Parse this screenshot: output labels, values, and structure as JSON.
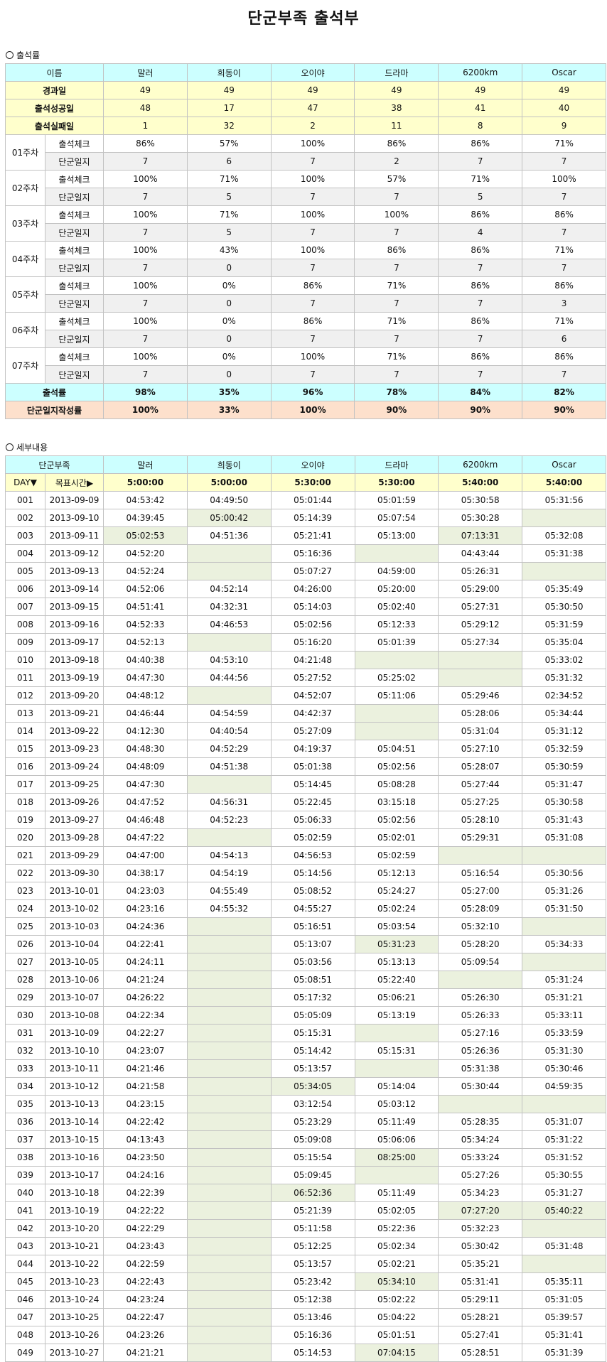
{
  "title": "단군부족 출석부",
  "section1": "출석률",
  "section2": "세부내용",
  "names": [
    "말러",
    "희동이",
    "오이야",
    "드라마",
    "6200km",
    "Oscar"
  ],
  "summary": {
    "name_header": "이름",
    "rows": [
      {
        "label": "경과일",
        "values": [
          "49",
          "49",
          "49",
          "49",
          "49",
          "49"
        ]
      },
      {
        "label": "출석성공일",
        "values": [
          "48",
          "17",
          "47",
          "38",
          "41",
          "40"
        ]
      },
      {
        "label": "출석실패일",
        "values": [
          "1",
          "32",
          "2",
          "11",
          "8",
          "9"
        ]
      }
    ],
    "check_label": "출석체크",
    "log_label": "단군일지",
    "weeks": [
      {
        "label": "01주차",
        "check": [
          "86%",
          "57%",
          "100%",
          "86%",
          "86%",
          "71%"
        ],
        "log": [
          "7",
          "6",
          "7",
          "2",
          "7",
          "7"
        ]
      },
      {
        "label": "02주차",
        "check": [
          "100%",
          "71%",
          "100%",
          "57%",
          "71%",
          "100%"
        ],
        "log": [
          "7",
          "5",
          "7",
          "7",
          "5",
          "7"
        ]
      },
      {
        "label": "03주차",
        "check": [
          "100%",
          "71%",
          "100%",
          "100%",
          "86%",
          "86%"
        ],
        "log": [
          "7",
          "5",
          "7",
          "7",
          "4",
          "7"
        ]
      },
      {
        "label": "04주차",
        "check": [
          "100%",
          "43%",
          "100%",
          "86%",
          "86%",
          "71%"
        ],
        "log": [
          "7",
          "0",
          "7",
          "7",
          "7",
          "7"
        ]
      },
      {
        "label": "05주차",
        "check": [
          "100%",
          "0%",
          "86%",
          "71%",
          "86%",
          "86%"
        ],
        "log": [
          "7",
          "0",
          "7",
          "7",
          "7",
          "3"
        ]
      },
      {
        "label": "06주차",
        "check": [
          "100%",
          "0%",
          "86%",
          "71%",
          "86%",
          "71%"
        ],
        "log": [
          "7",
          "0",
          "7",
          "7",
          "7",
          "6"
        ]
      },
      {
        "label": "07주차",
        "check": [
          "100%",
          "0%",
          "100%",
          "71%",
          "86%",
          "86%"
        ],
        "log": [
          "7",
          "0",
          "7",
          "7",
          "7",
          "7"
        ]
      }
    ],
    "rate": {
      "label": "출석률",
      "values": [
        "98%",
        "35%",
        "96%",
        "78%",
        "84%",
        "82%"
      ]
    },
    "log_rate": {
      "label": "단군일지작성률",
      "values": [
        "100%",
        "33%",
        "100%",
        "90%",
        "90%",
        "90%"
      ]
    }
  },
  "detail": {
    "tribe_header": "단군부족",
    "day_header": "DAY▼",
    "target_header": "목표시간▶",
    "targets": [
      "5:00:00",
      "5:00:00",
      "5:30:00",
      "5:30:00",
      "5:40:00",
      "5:40:00"
    ],
    "rows": [
      [
        "001",
        "2013-09-09",
        "04:53:42",
        "04:49:50",
        "05:01:44",
        "05:01:59",
        "05:30:58",
        "05:31:56"
      ],
      [
        "002",
        "2013-09-10",
        "04:39:45",
        "05:00:42",
        "05:14:39",
        "05:07:54",
        "05:30:28",
        ""
      ],
      [
        "003",
        "2013-09-11",
        "05:02:53",
        "04:51:36",
        "05:21:41",
        "05:13:00",
        "07:13:31",
        "05:32:08"
      ],
      [
        "004",
        "2013-09-12",
        "04:52:20",
        "",
        "05:16:36",
        "",
        "04:43:44",
        "05:31:38"
      ],
      [
        "005",
        "2013-09-13",
        "04:52:24",
        "",
        "05:07:27",
        "04:59:00",
        "05:26:31",
        ""
      ],
      [
        "006",
        "2013-09-14",
        "04:52:06",
        "04:52:14",
        "04:26:00",
        "05:20:00",
        "05:29:00",
        "05:35:49"
      ],
      [
        "007",
        "2013-09-15",
        "04:51:41",
        "04:32:31",
        "05:14:03",
        "05:02:40",
        "05:27:31",
        "05:30:50"
      ],
      [
        "008",
        "2013-09-16",
        "04:52:33",
        "04:46:53",
        "05:02:56",
        "05:12:33",
        "05:29:12",
        "05:31:59"
      ],
      [
        "009",
        "2013-09-17",
        "04:52:13",
        "",
        "05:16:20",
        "05:01:39",
        "05:27:34",
        "05:35:04"
      ],
      [
        "010",
        "2013-09-18",
        "04:40:38",
        "04:53:10",
        "04:21:48",
        "",
        "",
        "05:33:02"
      ],
      [
        "011",
        "2013-09-19",
        "04:47:30",
        "04:44:56",
        "05:27:52",
        "05:25:02",
        "",
        "05:31:32"
      ],
      [
        "012",
        "2013-09-20",
        "04:48:12",
        "",
        "04:52:07",
        "05:11:06",
        "05:29:46",
        "02:34:52"
      ],
      [
        "013",
        "2013-09-21",
        "04:46:44",
        "04:54:59",
        "04:42:37",
        "",
        "05:28:06",
        "05:34:44"
      ],
      [
        "014",
        "2013-09-22",
        "04:12:30",
        "04:40:54",
        "05:27:09",
        "",
        "05:31:04",
        "05:31:12"
      ],
      [
        "015",
        "2013-09-23",
        "04:48:30",
        "04:52:29",
        "04:19:37",
        "05:04:51",
        "05:27:10",
        "05:32:59"
      ],
      [
        "016",
        "2013-09-24",
        "04:48:09",
        "04:51:38",
        "05:01:38",
        "05:02:56",
        "05:28:07",
        "05:30:59"
      ],
      [
        "017",
        "2013-09-25",
        "04:47:30",
        "",
        "05:14:45",
        "05:08:28",
        "05:27:44",
        "05:31:47"
      ],
      [
        "018",
        "2013-09-26",
        "04:47:52",
        "04:56:31",
        "05:22:45",
        "03:15:18",
        "05:27:25",
        "05:30:58"
      ],
      [
        "019",
        "2013-09-27",
        "04:46:48",
        "04:52:23",
        "05:06:33",
        "05:02:56",
        "05:28:10",
        "05:31:43"
      ],
      [
        "020",
        "2013-09-28",
        "04:47:22",
        "",
        "05:02:59",
        "05:02:01",
        "05:29:31",
        "05:31:08"
      ],
      [
        "021",
        "2013-09-29",
        "04:47:00",
        "04:54:13",
        "04:56:53",
        "05:02:59",
        "",
        ""
      ],
      [
        "022",
        "2013-09-30",
        "04:38:17",
        "04:54:19",
        "05:14:56",
        "05:12:13",
        "05:16:54",
        "05:30:56"
      ],
      [
        "023",
        "2013-10-01",
        "04:23:03",
        "04:55:49",
        "05:08:52",
        "05:24:27",
        "05:27:00",
        "05:31:26"
      ],
      [
        "024",
        "2013-10-02",
        "04:23:16",
        "04:55:32",
        "04:55:27",
        "05:02:24",
        "05:28:09",
        "05:31:50"
      ],
      [
        "025",
        "2013-10-03",
        "04:24:36",
        "",
        "05:16:51",
        "05:03:54",
        "05:32:10",
        ""
      ],
      [
        "026",
        "2013-10-04",
        "04:22:41",
        "",
        "05:13:07",
        "05:31:23",
        "05:28:20",
        "05:34:33"
      ],
      [
        "027",
        "2013-10-05",
        "04:24:11",
        "",
        "05:03:56",
        "05:13:13",
        "05:09:54",
        ""
      ],
      [
        "028",
        "2013-10-06",
        "04:21:24",
        "",
        "05:08:51",
        "05:22:40",
        "",
        "05:31:24"
      ],
      [
        "029",
        "2013-10-07",
        "04:26:22",
        "",
        "05:17:32",
        "05:06:21",
        "05:26:30",
        "05:31:21"
      ],
      [
        "030",
        "2013-10-08",
        "04:22:34",
        "",
        "05:05:09",
        "05:13:19",
        "05:26:33",
        "05:33:11"
      ],
      [
        "031",
        "2013-10-09",
        "04:22:27",
        "",
        "05:15:31",
        "",
        "05:27:16",
        "05:33:59"
      ],
      [
        "032",
        "2013-10-10",
        "04:23:07",
        "",
        "05:14:42",
        "05:15:31",
        "05:26:36",
        "05:31:30"
      ],
      [
        "033",
        "2013-10-11",
        "04:21:46",
        "",
        "05:13:57",
        "",
        "05:31:38",
        "05:30:46"
      ],
      [
        "034",
        "2013-10-12",
        "04:21:58",
        "",
        "05:34:05",
        "05:14:04",
        "05:30:44",
        "04:59:35"
      ],
      [
        "035",
        "2013-10-13",
        "04:23:15",
        "",
        "03:12:54",
        "05:03:12",
        "",
        ""
      ],
      [
        "036",
        "2013-10-14",
        "04:22:42",
        "",
        "05:23:29",
        "05:11:49",
        "05:28:35",
        "05:31:07"
      ],
      [
        "037",
        "2013-10-15",
        "04:13:43",
        "",
        "05:09:08",
        "05:06:06",
        "05:34:24",
        "05:31:22"
      ],
      [
        "038",
        "2013-10-16",
        "04:23:50",
        "",
        "05:15:54",
        "08:25:00",
        "05:33:24",
        "05:31:52"
      ],
      [
        "039",
        "2013-10-17",
        "04:24:16",
        "",
        "05:09:45",
        "",
        "05:27:26",
        "05:30:55"
      ],
      [
        "040",
        "2013-10-18",
        "04:22:39",
        "",
        "06:52:36",
        "05:11:49",
        "05:34:23",
        "05:31:27"
      ],
      [
        "041",
        "2013-10-19",
        "04:22:22",
        "",
        "05:21:39",
        "05:02:05",
        "07:27:20",
        "05:40:22"
      ],
      [
        "042",
        "2013-10-20",
        "04:22:29",
        "",
        "05:11:58",
        "05:22:36",
        "05:32:23",
        ""
      ],
      [
        "043",
        "2013-10-21",
        "04:23:43",
        "",
        "05:12:25",
        "05:02:34",
        "05:30:42",
        "05:31:48"
      ],
      [
        "044",
        "2013-10-22",
        "04:22:59",
        "",
        "05:13:57",
        "05:02:21",
        "05:35:21",
        ""
      ],
      [
        "045",
        "2013-10-23",
        "04:22:43",
        "",
        "05:23:42",
        "05:34:10",
        "05:31:41",
        "05:35:11"
      ],
      [
        "046",
        "2013-10-24",
        "04:23:24",
        "",
        "05:12:38",
        "05:02:22",
        "05:29:11",
        "05:31:05"
      ],
      [
        "047",
        "2013-10-25",
        "04:22:47",
        "",
        "05:13:46",
        "05:04:22",
        "05:28:21",
        "05:39:57"
      ],
      [
        "048",
        "2013-10-26",
        "04:23:26",
        "",
        "05:16:36",
        "05:01:51",
        "05:27:41",
        "05:31:41"
      ],
      [
        "049",
        "2013-10-27",
        "04:21:21",
        "",
        "05:14:53",
        "07:04:15",
        "05:28:51",
        "05:31:39"
      ]
    ]
  }
}
